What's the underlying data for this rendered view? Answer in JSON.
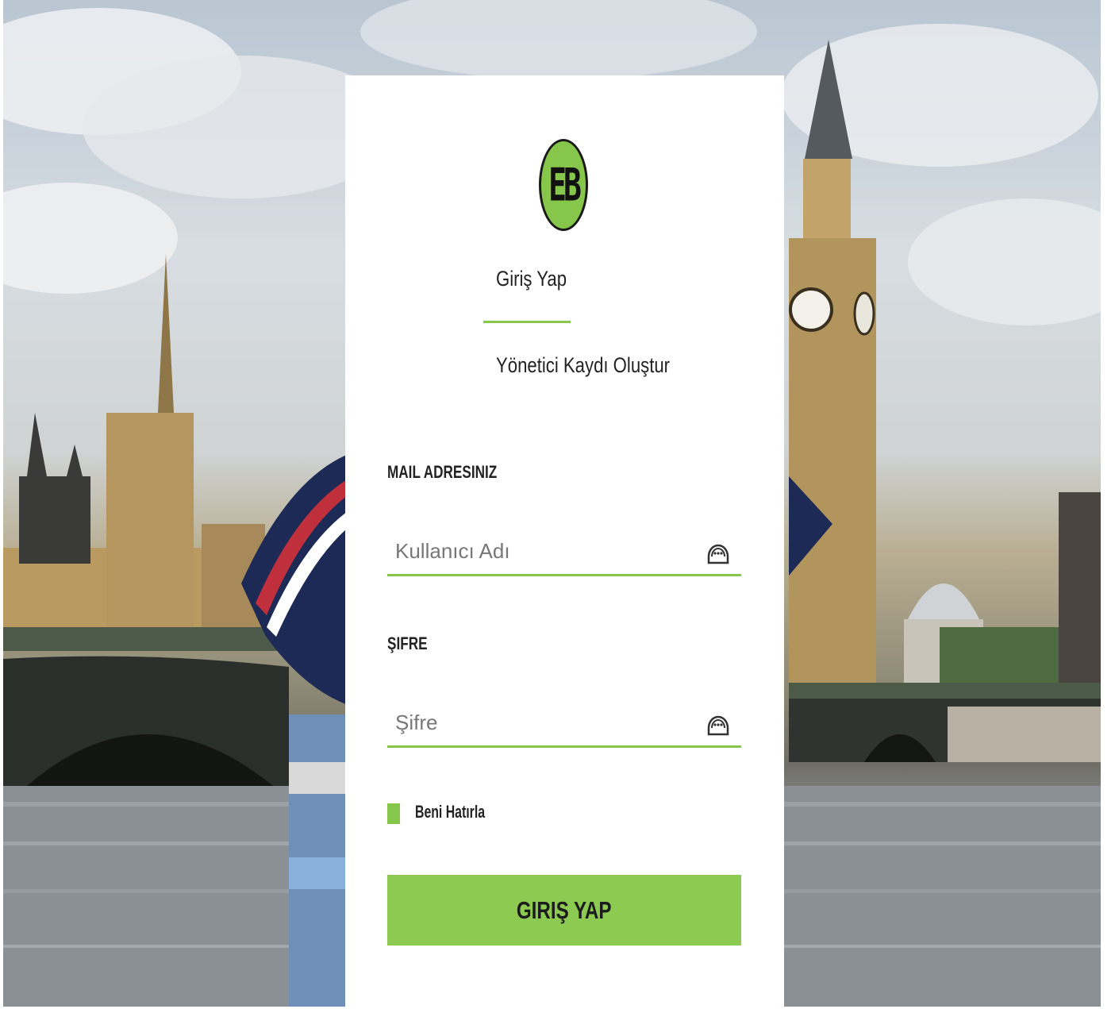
{
  "background": {
    "scene": "london-westminster-photo"
  },
  "logo": {
    "text": "EB",
    "color": "#86c64a"
  },
  "tabs": {
    "login_label": "Giriş Yap",
    "register_label": "Yönetici Kaydı Oluştur"
  },
  "form": {
    "email": {
      "label": "MAIL ADRESINIZ",
      "placeholder": "Kullanıcı Adı",
      "value": "",
      "icon": "user-icon"
    },
    "password": {
      "label": "ŞIFRE",
      "placeholder": "Şifre",
      "value": "",
      "icon": "lock-icon"
    },
    "remember_label": "Beni Hatırla",
    "submit_label": "GIRIŞ YAP"
  },
  "colors": {
    "accent": "#86c64a",
    "card": "#ffffff"
  }
}
